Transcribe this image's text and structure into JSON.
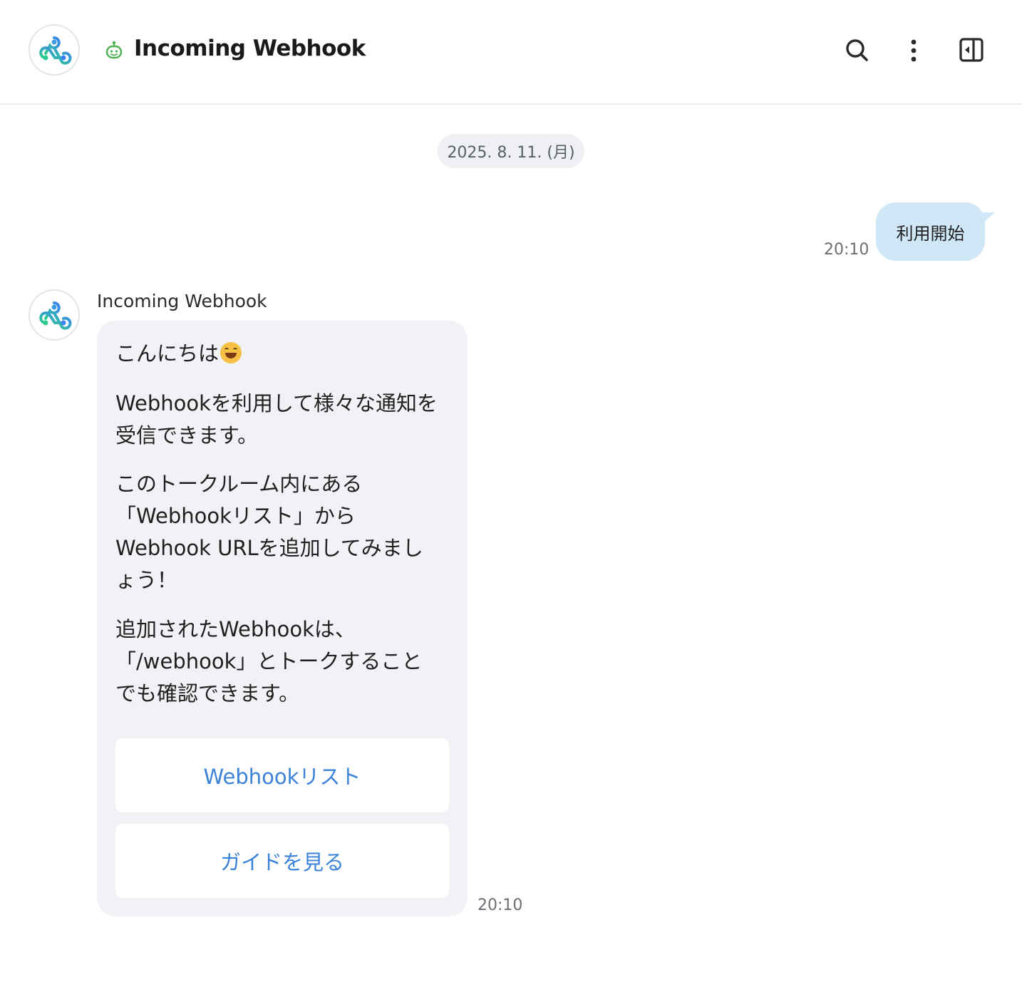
{
  "header": {
    "title": "Incoming Webhook",
    "icons": [
      "webhook-logo-icon",
      "bot-icon",
      "search-icon",
      "more-vertical-icon",
      "side-panel-icon"
    ]
  },
  "chat": {
    "date_chip": "2025. 8. 11. (月)",
    "my_message": {
      "text": "利用開始",
      "time": "20:10"
    },
    "bot_message": {
      "sender": "Incoming Webhook",
      "greeting": "こんにちは",
      "greeting_emoji": "grinning-face-emoji",
      "paragraph_2": "Webhookを利用して様々な通知を\n受信できます。",
      "paragraph_3": "このトークルーム内にある\n「Webhookリスト」から\nWebhook URLを追加してみまし\nょう！",
      "paragraph_4": "追加されたWebhookは、\n「/webhook」とトークすること\nでも確認できます。",
      "buttons": [
        "Webhookリスト",
        "ガイドを見る"
      ],
      "time": "20:10"
    }
  },
  "colors": {
    "my_bubble": "#cfe7f7",
    "bot_bubble": "#f1f2f5",
    "link": "#3b82d9",
    "date_chip": "#eef0f4",
    "bot_icon": "#4caf50"
  }
}
